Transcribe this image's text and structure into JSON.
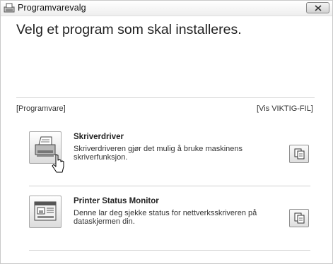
{
  "window": {
    "title": "Programvarevalg",
    "close_label": "X"
  },
  "header": {
    "heading": "Velg et program som skal installeres."
  },
  "section": {
    "software_label": "[Programvare]",
    "readme_link": "[Vis VIKTIG-FIL]"
  },
  "programs": [
    {
      "name": "Skriverdriver",
      "description": "Skriverdriveren gjør det mulig å bruke maskinens skriverfunksjon.",
      "icon": "printer-icon"
    },
    {
      "name": "Printer Status Monitor",
      "description": "Denne lar deg sjekke status for nettverksskriveren på dataskjermen din.",
      "icon": "status-monitor-icon"
    }
  ],
  "doc_button_icon": "document-icon"
}
